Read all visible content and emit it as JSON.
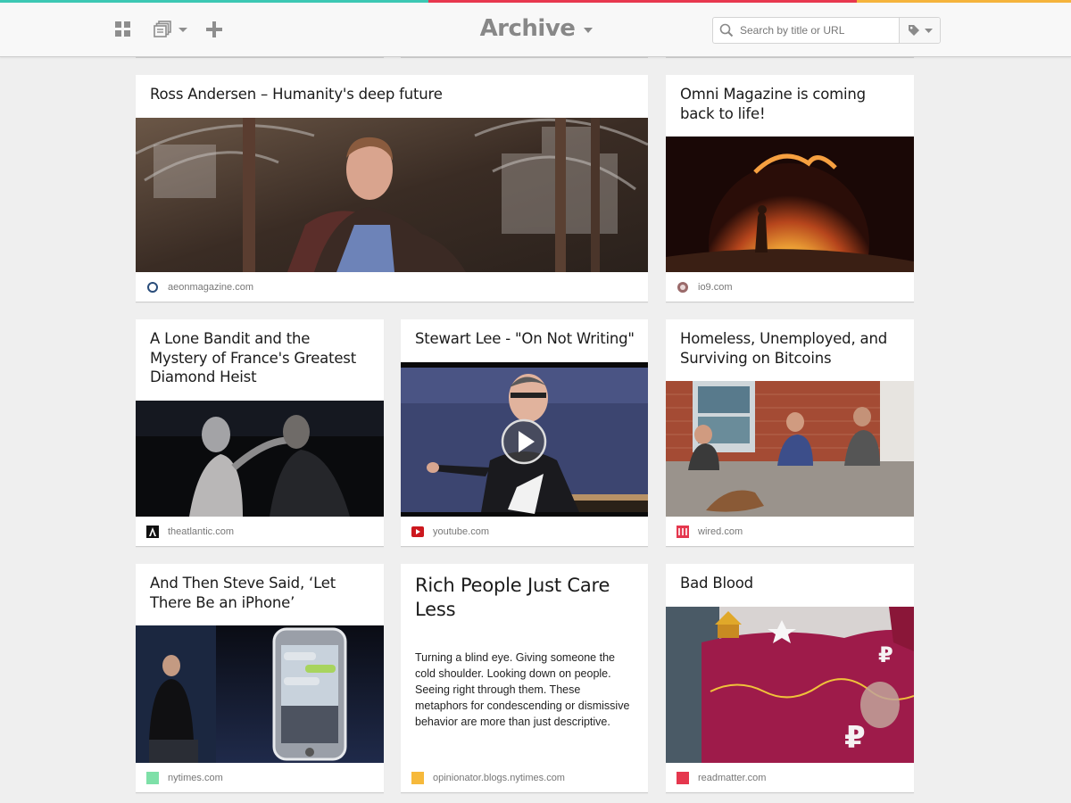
{
  "colors": {
    "strip": [
      "#3cc8b4",
      "#e8384f",
      "#e8384f",
      "#f5b43c"
    ],
    "favicon_nytimes": "#7ee0a8",
    "favicon_opinionator": "#f6b93b",
    "favicon_readmatter": "#e5374e",
    "favicon_wired": "#e5374e",
    "favicon_youtube": "#cc181e"
  },
  "header": {
    "title": "Archive",
    "search_placeholder": "Search by title or URL",
    "icons": [
      "grid-icon",
      "list-icon",
      "plus-icon",
      "caret-down-icon",
      "search-icon",
      "tag-icon"
    ]
  },
  "cards": [
    {
      "title": "Ross Andersen – Humanity's deep future",
      "domain": "aeonmagazine.com",
      "favicon": "aeon-favicon-icon"
    },
    {
      "title": "Omni Magazine is coming back to life!",
      "domain": "io9.com",
      "favicon": "io9-favicon-icon"
    },
    {
      "title": "A Lone Bandit and the Mystery of France's Greatest Diamond Heist",
      "domain": "theatlantic.com",
      "favicon": "atlantic-favicon-icon"
    },
    {
      "title": "Stewart Lee - \"On Not Writing\"",
      "domain": "youtube.com",
      "favicon": "youtube-favicon-icon"
    },
    {
      "title": "Homeless, Unemployed, and Surviving on Bitcoins",
      "domain": "wired.com",
      "favicon": "wired-favicon-icon"
    },
    {
      "title": "And Then Steve Said, ‘Let There Be an iPhone’",
      "domain": "nytimes.com",
      "favicon": "nytimes-favicon-icon"
    },
    {
      "title": "Rich People Just Care Less",
      "excerpt": "Turning a blind eye. Giving someone the cold shoulder. Looking down on people. Seeing right through them. These metaphors for condescending or dismissive behavior are more than just descriptive.",
      "domain": "opinionator.blogs.nytimes.com",
      "favicon": "opinionator-favicon-icon"
    },
    {
      "title": "Bad Blood",
      "domain": "readmatter.com",
      "favicon": "readmatter-favicon-icon"
    }
  ]
}
